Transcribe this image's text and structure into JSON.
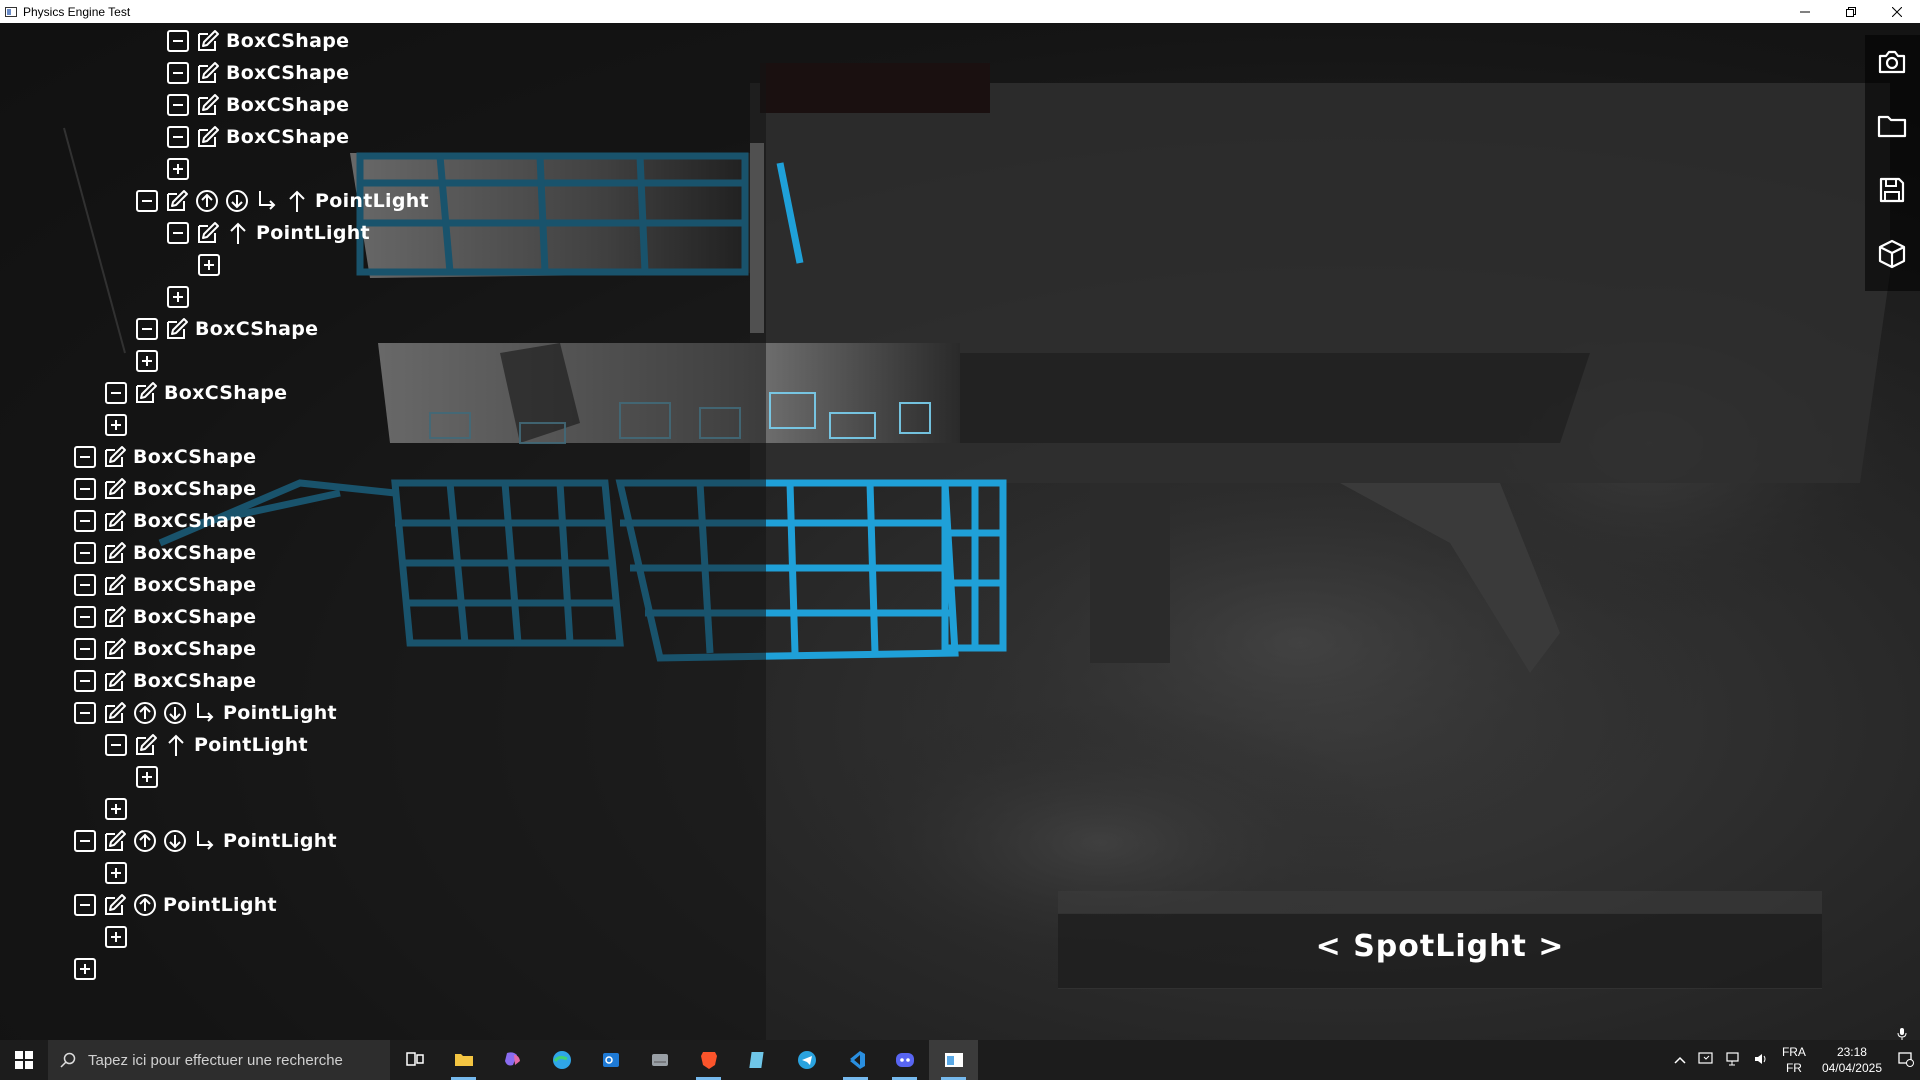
{
  "window": {
    "title": "Physics Engine Test",
    "minimize_icon": "minimize-icon",
    "maximize_icon": "restore-icon",
    "close_icon": "close-icon"
  },
  "hierarchy": {
    "nodes": [
      {
        "indent": 5,
        "controls": [
          "remove-icon",
          "edit-icon"
        ],
        "label": "BoxCShape"
      },
      {
        "indent": 5,
        "controls": [
          "remove-icon",
          "edit-icon"
        ],
        "label": "BoxCShape"
      },
      {
        "indent": 5,
        "controls": [
          "remove-icon",
          "edit-icon"
        ],
        "label": "BoxCShape"
      },
      {
        "indent": 5,
        "controls": [
          "remove-icon",
          "edit-icon"
        ],
        "label": "BoxCShape"
      },
      {
        "indent": 5,
        "controls": [
          "add-icon"
        ],
        "label": ""
      },
      {
        "indent": 4,
        "controls": [
          "remove-icon",
          "edit-icon",
          "move-up-icon",
          "move-down-icon",
          "child-arrow-icon",
          "up-arrow-icon"
        ],
        "label": "PointLight"
      },
      {
        "indent": 5,
        "controls": [
          "remove-icon",
          "edit-icon",
          "up-arrow-icon"
        ],
        "label": "PointLight"
      },
      {
        "indent": 6,
        "controls": [
          "add-icon"
        ],
        "label": ""
      },
      {
        "indent": 5,
        "controls": [
          "add-icon"
        ],
        "label": ""
      },
      {
        "indent": 4,
        "controls": [
          "remove-icon",
          "edit-icon"
        ],
        "label": "BoxCShape"
      },
      {
        "indent": 4,
        "controls": [
          "add-icon"
        ],
        "label": ""
      },
      {
        "indent": 3,
        "controls": [
          "remove-icon",
          "edit-icon"
        ],
        "label": "BoxCShape"
      },
      {
        "indent": 3,
        "controls": [
          "add-icon"
        ],
        "label": ""
      },
      {
        "indent": 2,
        "controls": [
          "remove-icon",
          "edit-icon"
        ],
        "label": "BoxCShape"
      },
      {
        "indent": 2,
        "controls": [
          "remove-icon",
          "edit-icon"
        ],
        "label": "BoxCShape"
      },
      {
        "indent": 2,
        "controls": [
          "remove-icon",
          "edit-icon"
        ],
        "label": "BoxCShape"
      },
      {
        "indent": 2,
        "controls": [
          "remove-icon",
          "edit-icon"
        ],
        "label": "BoxCShape"
      },
      {
        "indent": 2,
        "controls": [
          "remove-icon",
          "edit-icon"
        ],
        "label": "BoxCShape"
      },
      {
        "indent": 2,
        "controls": [
          "remove-icon",
          "edit-icon"
        ],
        "label": "BoxCShape"
      },
      {
        "indent": 2,
        "controls": [
          "remove-icon",
          "edit-icon"
        ],
        "label": "BoxCShape"
      },
      {
        "indent": 2,
        "controls": [
          "remove-icon",
          "edit-icon"
        ],
        "label": "BoxCShape"
      },
      {
        "indent": 2,
        "controls": [
          "remove-icon",
          "edit-icon",
          "move-up-icon",
          "move-down-icon",
          "child-arrow-icon"
        ],
        "label": "PointLight"
      },
      {
        "indent": 3,
        "controls": [
          "remove-icon",
          "edit-icon",
          "up-arrow-icon"
        ],
        "label": "PointLight"
      },
      {
        "indent": 4,
        "controls": [
          "add-icon"
        ],
        "label": ""
      },
      {
        "indent": 3,
        "controls": [
          "add-icon"
        ],
        "label": ""
      },
      {
        "indent": 2,
        "controls": [
          "remove-icon",
          "edit-icon",
          "move-up-icon",
          "move-down-icon",
          "child-arrow-icon"
        ],
        "label": "PointLight"
      },
      {
        "indent": 3,
        "controls": [
          "add-icon"
        ],
        "label": ""
      },
      {
        "indent": 2,
        "controls": [
          "remove-icon",
          "edit-icon",
          "move-up-icon"
        ],
        "label": "PointLight"
      },
      {
        "indent": 3,
        "controls": [
          "add-icon"
        ],
        "label": ""
      },
      {
        "indent": 2,
        "controls": [
          "add-icon"
        ],
        "label": ""
      }
    ]
  },
  "toolbar": {
    "items": [
      {
        "name": "camera-button",
        "icon": "camera-icon"
      },
      {
        "name": "open-folder-button",
        "icon": "folder-icon"
      },
      {
        "name": "save-button",
        "icon": "save-icon"
      },
      {
        "name": "add-object-button",
        "icon": "cube-icon"
      }
    ]
  },
  "selector": {
    "prev": "<",
    "label": "SpotLight",
    "next": ">"
  },
  "taskbar": {
    "search_placeholder": "Tapez ici pour effectuer une recherche",
    "apps": [
      {
        "name": "task-view",
        "icon": "task-view-icon"
      },
      {
        "name": "file-explorer",
        "icon": "folder-icon",
        "color": "#f4c542",
        "active": true
      },
      {
        "name": "copilot",
        "icon": "copilot-icon",
        "color": "#8a6cf0"
      },
      {
        "name": "edge",
        "icon": "edge-icon",
        "color": "#2fa6e8"
      },
      {
        "name": "outlook",
        "icon": "outlook-icon",
        "color": "#1e7ad6"
      },
      {
        "name": "files",
        "icon": "drive-icon",
        "color": "#9aa0a6"
      },
      {
        "name": "brave",
        "icon": "brave-icon",
        "color": "#fb542b",
        "active": true
      },
      {
        "name": "notepad",
        "icon": "notepad-icon",
        "color": "#6fc6e8"
      },
      {
        "name": "telegram",
        "icon": "telegram-icon",
        "color": "#2aa3df"
      },
      {
        "name": "vscode",
        "icon": "vscode-icon",
        "color": "#2a8fe0",
        "active": true
      },
      {
        "name": "discord",
        "icon": "discord-icon",
        "color": "#5865f2",
        "active": true
      },
      {
        "name": "physics-engine",
        "icon": "window-icon",
        "color": "#5aa9e6",
        "active": true,
        "current": true
      }
    ],
    "language": "FRA",
    "language_sub": "FR",
    "time": "23:18",
    "date": "04/04/2025"
  },
  "colors": {
    "accent_wire": "#1fa0d8",
    "background": "#141414"
  }
}
